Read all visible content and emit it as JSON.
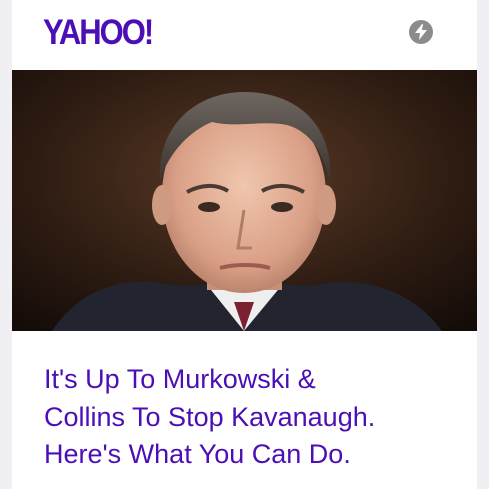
{
  "header": {
    "logo_text": "YAHOO!",
    "amp_icon": "lightning-bolt-icon"
  },
  "article": {
    "image_alt_icon": "news-photo",
    "headline_lines": [
      "It's Up To Murkowski &",
      "Collins To Stop Kavanaugh.",
      "Here's What You Can Do."
    ]
  },
  "colors": {
    "brand": "#4b0fb5",
    "background": "#efeff4",
    "badge": "#8c8c8c"
  }
}
